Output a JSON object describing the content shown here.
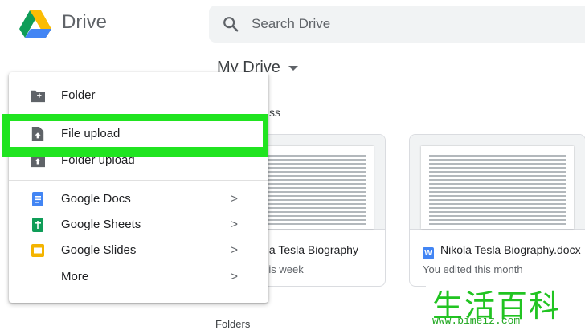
{
  "header": {
    "brand": "Drive",
    "search_placeholder": "Search Drive"
  },
  "main": {
    "title": "My Drive",
    "quick_access_label": "ss",
    "files": [
      {
        "name": "kola Tesla Biography",
        "subtitle": "l this week"
      },
      {
        "name": "Nikola Tesla Biography.docx",
        "subtitle": "You edited this month"
      }
    ],
    "folders_label": "Folders"
  },
  "new_menu": {
    "items": [
      {
        "label": "Folder",
        "icon": "folder-plus-icon"
      },
      {
        "label": "File upload",
        "icon": "file-upload-icon"
      },
      {
        "label": "Folder upload",
        "icon": "folder-upload-icon"
      },
      {
        "label": "Google Docs",
        "icon": "google-docs-icon",
        "chevron": ">"
      },
      {
        "label": "Google Sheets",
        "icon": "google-sheets-icon",
        "chevron": ">"
      },
      {
        "label": "Google Slides",
        "icon": "google-slides-icon",
        "chevron": ">"
      },
      {
        "label": "More",
        "chevron": ">"
      }
    ]
  },
  "colors": {
    "highlight": "#20e420",
    "docs": "#4285f4",
    "sheets": "#0f9d58",
    "slides": "#f4b400"
  },
  "watermark": {
    "brand_cn": "生活百科",
    "url": "www.bimeiz.com"
  }
}
